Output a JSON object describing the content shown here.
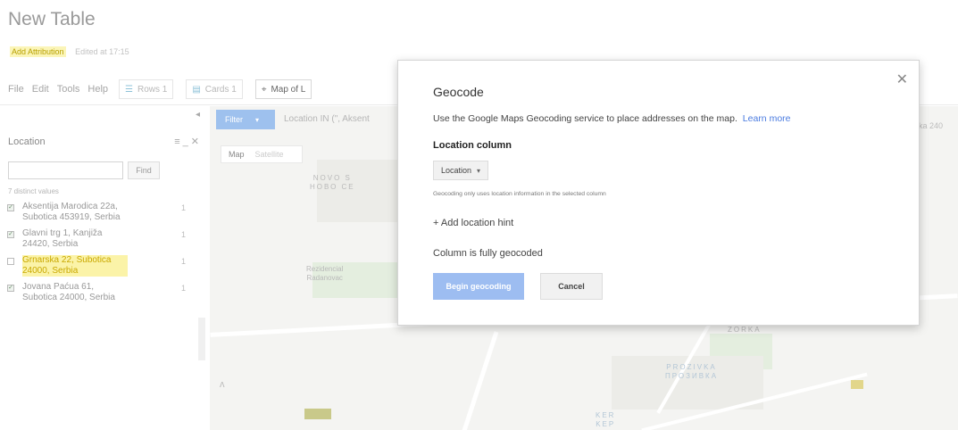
{
  "page": {
    "title": "New Table"
  },
  "subheader": {
    "attribution": "Add Attribution",
    "edited": "Edited at 17:15"
  },
  "menu": [
    "File",
    "Edit",
    "Tools",
    "Help"
  ],
  "tabs": [
    {
      "label": "Rows 1",
      "icon": "table-icon",
      "active": false
    },
    {
      "label": "Cards 1",
      "icon": "cards-icon",
      "active": false
    },
    {
      "label": "Map of L",
      "icon": "map-pin-icon",
      "active": true
    }
  ],
  "filter_panel": {
    "title": "Location",
    "search": {
      "value": "",
      "placeholder": ""
    },
    "find_label": "Find",
    "distinct_label": "7 distinct values",
    "items": [
      {
        "text": "Aksentija Marodica 22a, Subotica 453919, Serbia",
        "count": "1",
        "checked": true,
        "highlighted": false
      },
      {
        "text": "Glavni trg 1, Kanjiža 24420, Serbia",
        "count": "1",
        "checked": true,
        "highlighted": false
      },
      {
        "text": "Grnarska 22, Subotica 24000, Serbia",
        "count": "1",
        "checked": false,
        "highlighted": true
      },
      {
        "text": "Jovana Paćua 61, Subotica 24000, Serbia",
        "count": "1",
        "checked": true,
        "highlighted": false
      }
    ]
  },
  "map": {
    "filter_button": "Filter",
    "filter_summary": "Location IN (\", Aksent",
    "view_toggle": {
      "map": "Map",
      "satellite": "Satellite"
    },
    "labels": [
      {
        "text": "NOVO S\nНОВО СЕ",
        "style": "gray"
      },
      {
        "text": "Rezidencial\nRadanovac",
        "style": "gray"
      },
      {
        "text": "ZORKA",
        "style": "gray"
      },
      {
        "text": "PROZIVKA\nПРОЗИВКА",
        "style": "blue"
      },
      {
        "text": "KER\nKEP",
        "style": "blue"
      }
    ],
    "right_peek": "ka 240"
  },
  "dialog": {
    "title": "Geocode",
    "description": "Use the Google Maps Geocoding service to place addresses on the map.",
    "learn_more": "Learn more",
    "location_column_label": "Location column",
    "location_select": "Location",
    "help": "Geocoding only uses location information in the selected column",
    "add_hint": "+ Add location hint",
    "status": "Column is fully geocoded",
    "begin_button": "Begin geocoding",
    "cancel_button": "Cancel"
  },
  "colors": {
    "accent": "#9dbdf1",
    "link": "#4a7be0",
    "highlight": "#fbf3a8"
  }
}
